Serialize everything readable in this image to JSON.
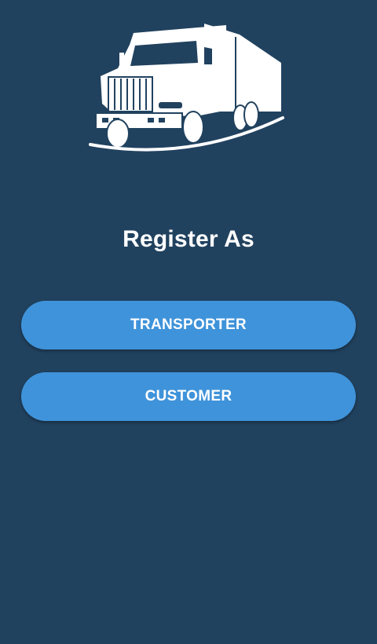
{
  "register": {
    "title": "Register As",
    "buttons": {
      "transporter_label": "TRANSPORTER",
      "customer_label": "CUSTOMER"
    }
  },
  "colors": {
    "background": "#21425f",
    "button": "#3f93da",
    "text": "#ffffff"
  },
  "icons": {
    "logo": "truck-icon"
  }
}
